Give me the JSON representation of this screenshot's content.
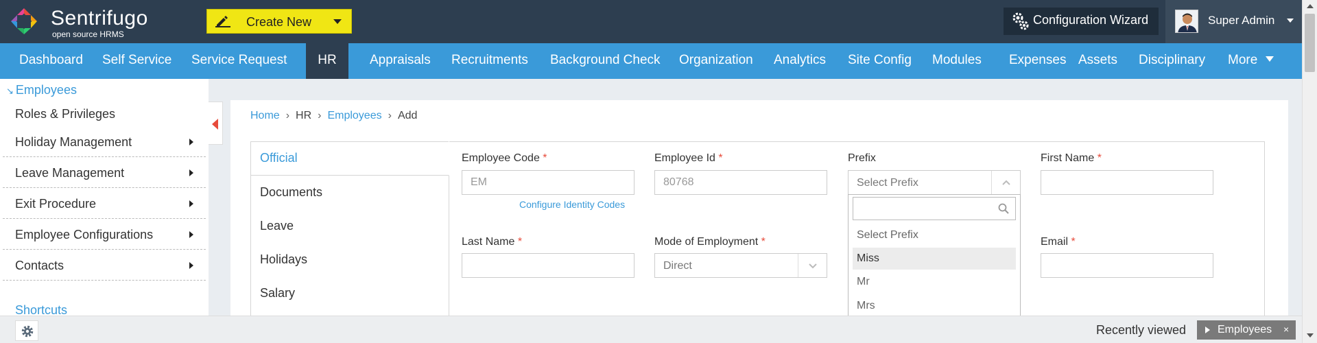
{
  "app": {
    "name": "Sentrifugo",
    "tagline": "open source HRMS"
  },
  "header": {
    "create_label": "Create New",
    "wizard_label": "Configuration Wizard",
    "user_name": "Super Admin"
  },
  "nav": {
    "items": [
      "Dashboard",
      "Self Service",
      "Service Request",
      "HR",
      "Appraisals",
      "Recruitments",
      "Background Check",
      "Organization",
      "Analytics",
      "Site Config",
      "Modules",
      "Expenses",
      "Assets",
      "Disciplinary",
      "More"
    ],
    "active": "HR"
  },
  "sidebar": {
    "heading": "Employees",
    "items": [
      {
        "label": "Roles & Privileges",
        "submenu": false
      },
      {
        "label": "Holiday Management",
        "submenu": true
      },
      {
        "label": "Leave Management",
        "submenu": true
      },
      {
        "label": "Exit Procedure",
        "submenu": true
      },
      {
        "label": "Employee Configurations",
        "submenu": true
      },
      {
        "label": "Contacts",
        "submenu": true
      }
    ],
    "shortcuts": "Shortcuts"
  },
  "breadcrumb": {
    "home": "Home",
    "hr": "HR",
    "employees": "Employees",
    "current": "Add",
    "separator": "›"
  },
  "tabs": [
    "Official",
    "Documents",
    "Leave",
    "Holidays",
    "Salary"
  ],
  "form": {
    "employee_code": {
      "label": "Employee Code",
      "value": "EM"
    },
    "configure_link": "Configure Identity Codes",
    "employee_id": {
      "label": "Employee Id",
      "value": "80768"
    },
    "prefix": {
      "label": "Prefix",
      "value": "Select Prefix"
    },
    "first_name": {
      "label": "First Name",
      "value": ""
    },
    "last_name": {
      "label": "Last Name",
      "value": ""
    },
    "mode_of_employment": {
      "label": "Mode of Employment",
      "value": "Direct"
    },
    "email": {
      "label": "Email",
      "value": ""
    },
    "required_mark": "*"
  },
  "prefix_dropdown": {
    "search_value": "",
    "options": [
      "Select Prefix",
      "Miss",
      "Mr",
      "Mrs"
    ],
    "highlighted": "Miss"
  },
  "bottom": {
    "recent_label": "Recently viewed",
    "recent_chip": "Employees",
    "close_glyph": "×"
  },
  "colors": {
    "header_bg": "#2d3e50",
    "nav_bg": "#3a9ad9",
    "create_btn": "#f0e614",
    "link": "#3a9ad9",
    "required": "#e74c3c"
  }
}
